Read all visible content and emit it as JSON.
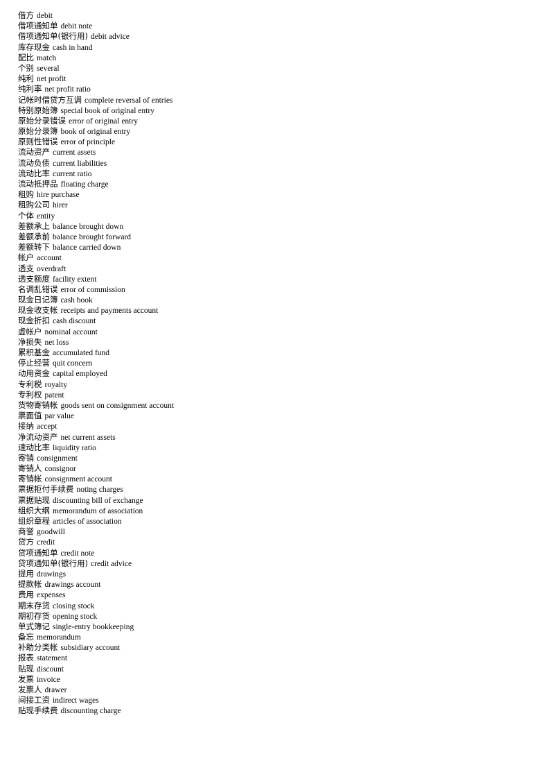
{
  "document": {
    "background_color": "#ffffff",
    "text_color": "#000000",
    "entries": [
      {
        "cn": "借方",
        "en": "debit"
      },
      {
        "cn": "借项通知单",
        "en": "debit note"
      },
      {
        "cn": "借项通知单(银行用)",
        "en": "debit advice"
      },
      {
        "cn": "库存现金",
        "en": "cash in hand"
      },
      {
        "cn": "配比",
        "en": "match"
      },
      {
        "cn": "个别",
        "en": "several"
      },
      {
        "cn": "纯利",
        "en": "net profit"
      },
      {
        "cn": "纯利率",
        "en": "net profit ratio"
      },
      {
        "cn": "记帐时借贷方互调",
        "en": "complete reversal of entries"
      },
      {
        "cn": "特别原始簿",
        "en": "special book of original entry"
      },
      {
        "cn": "原始分录错误",
        "en": "error of original entry"
      },
      {
        "cn": "原始分录簿",
        "en": "book of original entry"
      },
      {
        "cn": "原则性错误",
        "en": "error of principle"
      },
      {
        "cn": "流动资产",
        "en": "current assets"
      },
      {
        "cn": "流动负债",
        "en": "current liabilities"
      },
      {
        "cn": "流动比率",
        "en": "current ratio"
      },
      {
        "cn": "流动抵押品",
        "en": "floating charge"
      },
      {
        "cn": "租购",
        "en": "hire purchase"
      },
      {
        "cn": "租购公司",
        "en": "hirer"
      },
      {
        "cn": "个体",
        "en": "entity"
      },
      {
        "cn": "差额承上",
        "en": "balance brought down"
      },
      {
        "cn": "差额承前",
        "en": "balance brought forward"
      },
      {
        "cn": "差额转下",
        "en": "balance carried down"
      },
      {
        "cn": "帐户",
        "en": "account"
      },
      {
        "cn": "透支",
        "en": "overdraft"
      },
      {
        "cn": "透支额度",
        "en": "facility extent"
      },
      {
        "cn": "名调乱错误",
        "en": "error of commission"
      },
      {
        "cn": "现金日记簿",
        "en": "cash book"
      },
      {
        "cn": "现金收支帐",
        "en": "receipts and payments account"
      },
      {
        "cn": "现金折扣",
        "en": "cash discount"
      },
      {
        "cn": "虚帐户",
        "en": "nominal account"
      },
      {
        "cn": "净损失",
        "en": "net loss"
      },
      {
        "cn": "累积基金",
        "en": "accumulated fund"
      },
      {
        "cn": "停止经营",
        "en": "quit concern"
      },
      {
        "cn": "动用资金",
        "en": "capital employed"
      },
      {
        "cn": "专利税",
        "en": "royalty"
      },
      {
        "cn": "专利权",
        "en": "patent"
      },
      {
        "cn": "货物寄销帐",
        "en": "goods sent on consignment account"
      },
      {
        "cn": "票面值",
        "en": "par value"
      },
      {
        "cn": "接纳",
        "en": "accept"
      },
      {
        "cn": "净流动资产",
        "en": "net current assets"
      },
      {
        "cn": "速动比率",
        "en": "liquidity ratio"
      },
      {
        "cn": "寄销",
        "en": "consignment"
      },
      {
        "cn": "寄销人",
        "en": "consignor"
      },
      {
        "cn": "寄销帐",
        "en": "consignment account"
      },
      {
        "cn": "票据拒付手续费",
        "en": "noting charges"
      },
      {
        "cn": "票据贴现",
        "en": "discounting bill of exchange"
      },
      {
        "cn": "组织大纲",
        "en": "memorandum of association"
      },
      {
        "cn": "组织章程",
        "en": "articles of association"
      },
      {
        "cn": "商誉",
        "en": "goodwill"
      },
      {
        "cn": "贷方",
        "en": "credit"
      },
      {
        "cn": "贷项通知单",
        "en": "credit note"
      },
      {
        "cn": "贷项通知单(银行用)",
        "en": "credit advice"
      },
      {
        "cn": "提用",
        "en": "drawings"
      },
      {
        "cn": "提款帐",
        "en": "drawings account"
      },
      {
        "cn": "费用",
        "en": "expenses"
      },
      {
        "cn": "期末存货",
        "en": "closing stock"
      },
      {
        "cn": "期初存货",
        "en": "opening stock"
      },
      {
        "cn": "单式簿记",
        "en": "single-entry bookkeeping"
      },
      {
        "cn": "备忘",
        "en": "memorandum"
      },
      {
        "cn": "补助分类帐",
        "en": "subsidiary account"
      },
      {
        "cn": "报表",
        "en": "statement"
      },
      {
        "cn": "贴现",
        "en": "discount"
      },
      {
        "cn": "发票",
        "en": "invoice"
      },
      {
        "cn": "发票人",
        "en": "drawer"
      },
      {
        "cn": "间接工资",
        "en": "indirect wages"
      },
      {
        "cn": "贴现手续费",
        "en": "discounting charge"
      }
    ]
  }
}
